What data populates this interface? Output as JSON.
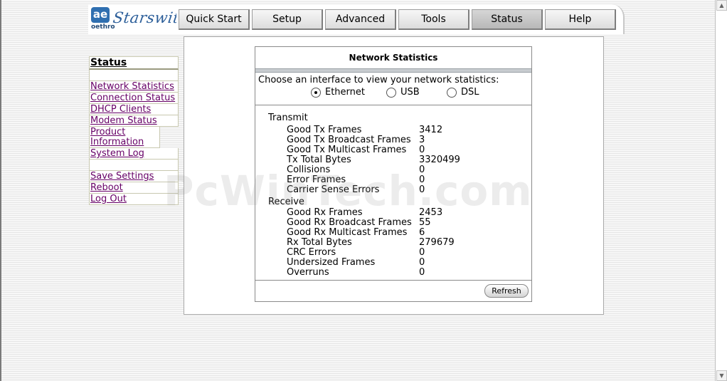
{
  "brand": {
    "logo_mark": "ae",
    "logo_sub": "oethro",
    "logo_name": "Starswitch"
  },
  "tabs": [
    {
      "label": "Quick Start"
    },
    {
      "label": "Setup"
    },
    {
      "label": "Advanced"
    },
    {
      "label": "Tools"
    },
    {
      "label": "Status",
      "active": true
    },
    {
      "label": "Help"
    }
  ],
  "sidebar": {
    "heading": "Status",
    "items": [
      {
        "label": "Network Statistics"
      },
      {
        "label": "Connection Status"
      },
      {
        "label": "DHCP Clients"
      },
      {
        "label": "Modem Status"
      },
      {
        "label": "Product Information"
      },
      {
        "label": "System Log"
      },
      {
        "label": "Save Settings"
      },
      {
        "label": "Reboot"
      },
      {
        "label": "Log Out"
      }
    ]
  },
  "stats": {
    "title": "Network Statistics",
    "choose_text": "Choose an interface to view your network statistics:",
    "interfaces": [
      {
        "label": "Ethernet",
        "checked": true
      },
      {
        "label": "USB",
        "checked": false
      },
      {
        "label": "DSL",
        "checked": false
      }
    ],
    "transmit_label": "Transmit",
    "transmit": [
      {
        "label": "Good Tx Frames",
        "value": "3412"
      },
      {
        "label": "Good Tx Broadcast Frames",
        "value": "3"
      },
      {
        "label": "Good Tx Multicast Frames",
        "value": "0"
      },
      {
        "label": "Tx Total Bytes",
        "value": "3320499"
      },
      {
        "label": "Collisions",
        "value": "0"
      },
      {
        "label": "Error Frames",
        "value": "0"
      },
      {
        "label": "Carrier Sense Errors",
        "value": "0"
      }
    ],
    "receive_label": "Receive",
    "receive": [
      {
        "label": "Good Rx Frames",
        "value": "2453"
      },
      {
        "label": "Good Rx Broadcast Frames",
        "value": "55"
      },
      {
        "label": "Good Rx Multicast Frames",
        "value": "6"
      },
      {
        "label": "Rx Total Bytes",
        "value": "279679"
      },
      {
        "label": "CRC Errors",
        "value": "0"
      },
      {
        "label": "Undersized Frames",
        "value": "0"
      },
      {
        "label": "Overruns",
        "value": "0"
      }
    ],
    "refresh_label": "Refresh"
  },
  "watermark": "PcWinTech.com",
  "scrollbar": {
    "up_glyph": "▲",
    "down_glyph": "▼"
  }
}
